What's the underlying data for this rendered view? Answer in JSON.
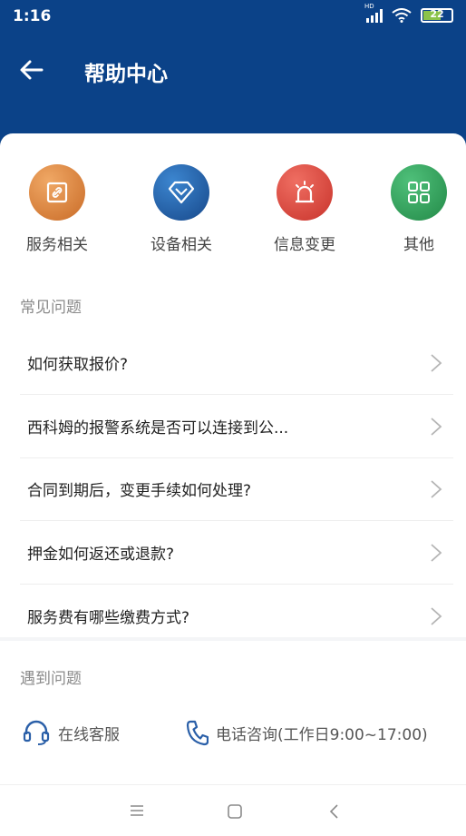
{
  "status": {
    "time": "1:16",
    "hd": "HD",
    "battery": "22"
  },
  "header": {
    "title": "帮助中心"
  },
  "categories": [
    {
      "label": "服务相关",
      "icon": "link-icon",
      "color": "#d8823e"
    },
    {
      "label": "设备相关",
      "icon": "diamond-icon",
      "color": "#1f5fa8"
    },
    {
      "label": "信息变更",
      "icon": "alarm-light-icon",
      "color": "#d9443c"
    },
    {
      "label": "其他",
      "icon": "grid-icon",
      "color": "#2e9b57"
    }
  ],
  "faq": {
    "title": "常见问题",
    "items": [
      "如何获取报价?",
      "西科姆的报警系统是否可以连接到公...",
      "合同到期后，变更手续如何处理?",
      "押金如何返还或退款?",
      "服务费有哪些缴费方式?"
    ]
  },
  "contact": {
    "title": "遇到问题",
    "online": "在线客服",
    "phone": "电话咨询(工作日9:00~17:00)"
  }
}
